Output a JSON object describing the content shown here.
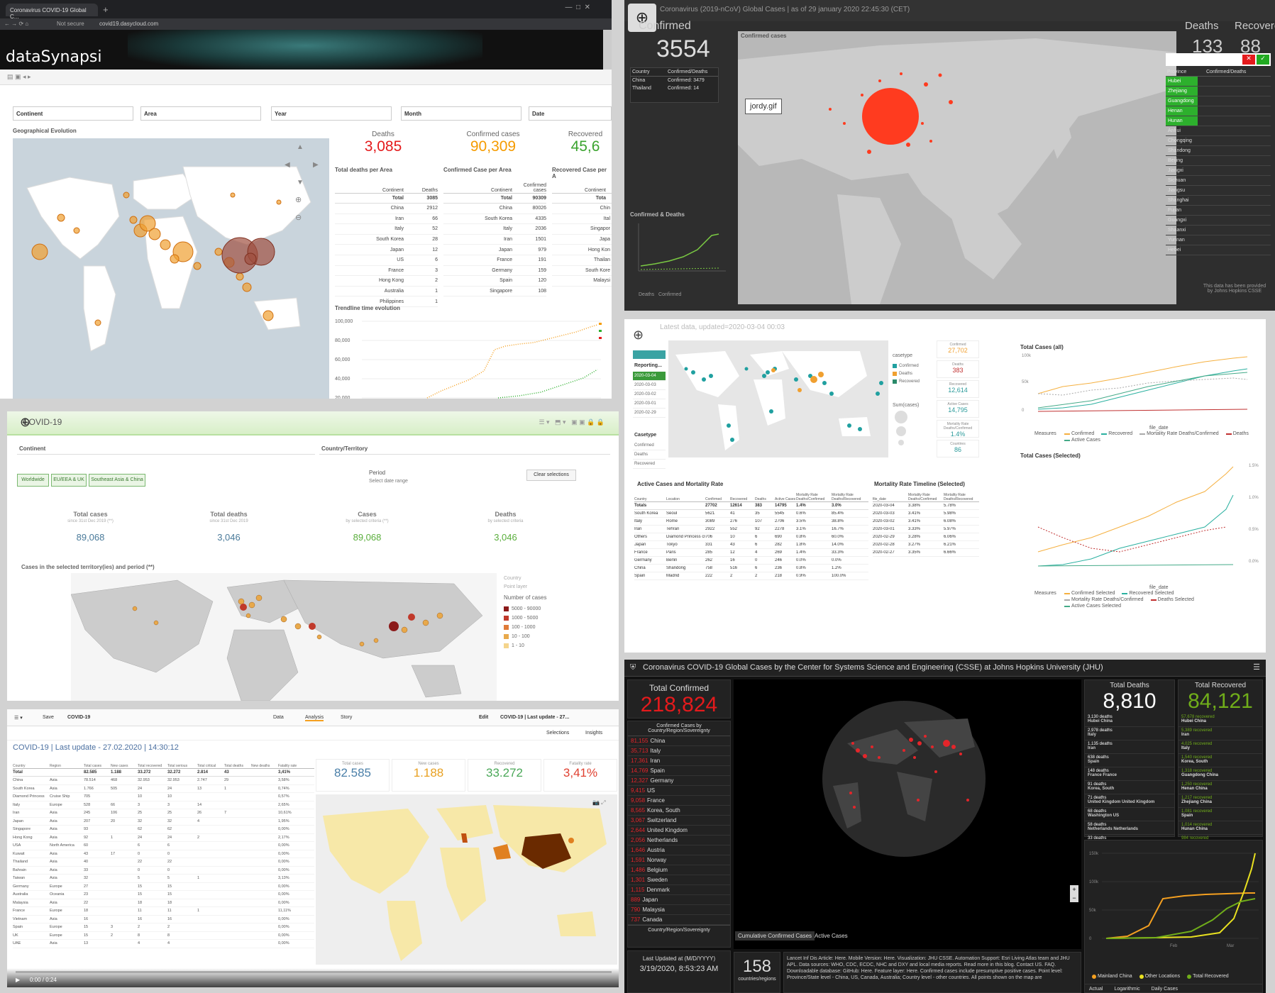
{
  "p1": {
    "tab_title": "Coronavirus COVID-19 Global C...",
    "url": "covid19.dasycloud.com",
    "not_secure": "Not secure",
    "brand": "dataSynapsi",
    "filters": [
      "Continent",
      "Area",
      "Year",
      "Month",
      "Date"
    ],
    "map_title": "Geographical Evolution",
    "kpis": [
      {
        "label": "Deaths",
        "value": "3,085",
        "color": "#e41a1c"
      },
      {
        "label": "Confirmed cases",
        "value": "90,309",
        "color": "#f59b00"
      },
      {
        "label": "Recovered",
        "value": "45,6",
        "color": "#3aa32e"
      }
    ],
    "t1": {
      "title": "Total deaths per Area",
      "h1": "Continent",
      "h2": "Deaths",
      "total_label": "Total",
      "total": "3085",
      "rows": [
        [
          "China",
          "2912"
        ],
        [
          "Iran",
          "66"
        ],
        [
          "Italy",
          "52"
        ],
        [
          "South Korea",
          "28"
        ],
        [
          "Japan",
          "12"
        ],
        [
          "US",
          "6"
        ],
        [
          "France",
          "3"
        ],
        [
          "Hong Kong",
          "2"
        ],
        [
          "Australia",
          "1"
        ],
        [
          "Philippines",
          "1"
        ]
      ]
    },
    "t2": {
      "title": "Confirmed Case per Area",
      "h1": "Continent",
      "h2": "Confirmed cases",
      "total_label": "Total",
      "total": "90309",
      "rows": [
        [
          "China",
          "80026"
        ],
        [
          "South Korea",
          "4335"
        ],
        [
          "Italy",
          "2036"
        ],
        [
          "Iran",
          "1501"
        ],
        [
          "Japan",
          "979"
        ],
        [
          "France",
          "191"
        ],
        [
          "Germany",
          "159"
        ],
        [
          "Spain",
          "120"
        ],
        [
          "Singapore",
          "108"
        ]
      ]
    },
    "t3": {
      "title": "Recovered Case per A",
      "h1": "Continent",
      "total_label": "Tota",
      "rows": [
        "Chin",
        "Ital",
        "Singapor",
        "Japa",
        "Hong Kon",
        "Thailan",
        "South Kore",
        "Malaysi"
      ]
    },
    "trend_title": "Trendline time evolution",
    "trend_ticks": [
      "100,000",
      "80,000",
      "60,000",
      "40,000",
      "20,000"
    ]
  },
  "p2": {
    "title": "Coronavirus (2019-nCoV) Global Cases | as of 29 january 2020 22:45:30 (CET)",
    "confirmed_label": "Confirmed",
    "confirmed": "3554",
    "deaths_label": "Deaths",
    "deaths": "133",
    "recovered_label": "Recovered",
    "recovered": "88",
    "map_label": "Confirmed cases",
    "gif_label": "jordy.gif",
    "left_table": {
      "h1": "Country",
      "h2": "Confirmed/Deaths",
      "rows": [
        [
          "China",
          "Confirmed: 3479"
        ],
        [
          "Thailand",
          "Confirmed: 14"
        ]
      ]
    },
    "chart_label": "Confirmed & Deaths",
    "chart_legend": [
      "Deaths",
      "Confirmed"
    ],
    "right_table": {
      "h1": "Province",
      "h2": "Confirmed/Deaths",
      "rows": [
        "Hubei",
        "Zhejiang",
        "Guangdong",
        "Henan",
        "Hunan",
        "Anhui",
        "Chongqing",
        "Shandong",
        "Beijing",
        "Jiangxi",
        "Sichuan",
        "Jiangsu",
        "Shanghai",
        "Fujian",
        "Guangxi",
        "Shaanxi",
        "Yunnan",
        "Hebei"
      ]
    },
    "footer": "This data has been provided by Johns Hopkins CSSE"
  },
  "p3": {
    "header": "Latest data, updated=2020-03-04 00:03",
    "reporting": "Reporting...",
    "dates": [
      "2020-03-04",
      "2020-03-03",
      "2020-03-02",
      "2020-03-01",
      "2020-02-29"
    ],
    "casetype_label": "Casetype",
    "casetypes": [
      "Confirmed",
      "Deaths",
      "Recovered"
    ],
    "legend_title": "casetype",
    "legend": [
      "Confirmed",
      "Deaths",
      "Recovered"
    ],
    "size_label": "Sum(cases)",
    "kpis": [
      {
        "label": "Confirmed",
        "value": "27,702"
      },
      {
        "label": "Deaths",
        "value": "383"
      },
      {
        "label": "Recovered",
        "value": "12,614"
      },
      {
        "label": "Active Cases",
        "value": "14,795"
      },
      {
        "label": "Mortality Rate Deaths/Confirmed",
        "value": "1.4%"
      },
      {
        "label": "Countries",
        "value": "86"
      }
    ],
    "tbl_title": "Active Cases and Mortality Rate",
    "tbl_head": [
      "Country",
      "Location",
      "Confirmed",
      "Recovered",
      "Deaths",
      "Active Cases",
      "Mortality Rate Deaths/Confirmed",
      "Mortality Rate Deaths/Recovered"
    ],
    "tbl_total": [
      "Totals",
      "",
      "27702",
      "12614",
      "383",
      "14795",
      "1.4%",
      "3.0%"
    ],
    "tbl_rows": [
      [
        "South Korea",
        "Seoul",
        "5621",
        "41",
        "35",
        "5545",
        "0.6%",
        "85.4%"
      ],
      [
        "Italy",
        "Rome",
        "3089",
        "276",
        "107",
        "2706",
        "3.5%",
        "38.8%"
      ],
      [
        "Iran",
        "Tehran",
        "2922",
        "552",
        "92",
        "2278",
        "3.1%",
        "16.7%"
      ],
      [
        "Others",
        "Diamond Princess cruise ship",
        "706",
        "10",
        "6",
        "690",
        "0.8%",
        "60.0%"
      ],
      [
        "Japan",
        "Tokyo",
        "331",
        "43",
        "6",
        "282",
        "1.8%",
        "14.0%"
      ],
      [
        "France",
        "Paris",
        "285",
        "12",
        "4",
        "269",
        "1.4%",
        "33.3%"
      ],
      [
        "Germany",
        "Berlin",
        "262",
        "16",
        "0",
        "246",
        "0.0%",
        "0.0%"
      ],
      [
        "China",
        "Shandong",
        "758",
        "516",
        "6",
        "236",
        "0.8%",
        "1.2%"
      ],
      [
        "Spain",
        "Madrid",
        "222",
        "2",
        "2",
        "218",
        "0.9%",
        "100.0%"
      ]
    ],
    "timeline_title": "Mortality Rate Timeline (Selected)",
    "timeline_head": [
      "file_date",
      "Mortality Rate Deaths/Confirmed",
      "Mortality Rate Deaths/Recovered"
    ],
    "timeline_rows": [
      [
        "2020-03-04",
        "3.38%",
        "5.78%"
      ],
      [
        "2020-03-03",
        "3.41%",
        "5.98%"
      ],
      [
        "2020-03-02",
        "3.41%",
        "6.08%"
      ],
      [
        "2020-03-01",
        "3.33%",
        "5.97%"
      ],
      [
        "2020-02-29",
        "3.28%",
        "6.06%"
      ],
      [
        "2020-02-28",
        "3.27%",
        "6.21%"
      ],
      [
        "2020-02-27",
        "3.35%",
        "6.66%"
      ]
    ],
    "chart1_title": "Total Cases (all)",
    "chart1_legend": [
      "Confirmed",
      "Recovered",
      "Mortality Rate Deaths/Confirmed",
      "Deaths",
      "Active Cases"
    ],
    "chart1_measures": "Measures",
    "chart1_x": "file_date",
    "chart2_title": "Total Cases (Selected)",
    "chart2_legend": [
      "Confirmed Selected",
      "Recovered Selected",
      "Mortality Rate Deaths/Confirmed",
      "Deaths Selected",
      "Active Cases Selected"
    ],
    "chart2_measures": "Measures",
    "chart2_x": "file_date",
    "c1_y": [
      "100k",
      "50k",
      "0"
    ],
    "c2_y": [
      "1.5%",
      "1.0%",
      "0.5%",
      "0.0%"
    ]
  },
  "p4": {
    "title": "COVID-19",
    "filters": [
      "Continent",
      "Country/Territory"
    ],
    "buttons": [
      "Worldwide",
      "EU/EEA & UK",
      "Southeast Asia & China"
    ],
    "period_label": "Period",
    "period_value": "Select date range",
    "clear": "Clear selections",
    "kpis": [
      {
        "label": "Total cases",
        "sub": "since 31st Dec 2019 (**)",
        "value": "89,068",
        "color": "#4a7a9a"
      },
      {
        "label": "Total deaths",
        "sub": "since 31st Dec 2019",
        "value": "3,046",
        "color": "#4a7a9a"
      },
      {
        "label": "Cases",
        "sub": "by selected criteria (**)",
        "value": "89,068",
        "color": "#5aae3c"
      },
      {
        "label": "Deaths",
        "sub": "by selected criteria",
        "value": "3,046",
        "color": "#5aae3c"
      }
    ],
    "map_title": "Cases in the selected territory(ies) and period (**)",
    "legend_title": "Country",
    "legend_sub": "Point layer",
    "legend_head": "Number of cases",
    "legend": [
      [
        "5000 - 90000",
        "#8b1a1a"
      ],
      [
        "1000 - 5000",
        "#c0392b"
      ],
      [
        "100 - 1000",
        "#e07b39"
      ],
      [
        "10 - 100",
        "#e8a94b"
      ],
      [
        "1 - 10",
        "#f4d58d"
      ]
    ]
  },
  "p5": {
    "menu": [
      "Save",
      "COVID-19"
    ],
    "tabs": [
      "Data",
      "Analysis",
      "Story"
    ],
    "tabbar_right": [
      "Edit",
      "COVID-19 | Last update - 27..."
    ],
    "sel": [
      "Selections",
      "Insights"
    ],
    "title": "COVID-19 | Last update - 27.02.2020 | 14:30:12",
    "tbl_head": [
      "Country",
      "Region",
      "Total cases",
      "New cases",
      "Total recovered",
      "Total serious",
      "Total critical",
      "Total deaths",
      "New deaths",
      "Fatality rate"
    ],
    "tbl_total": [
      "Total",
      "",
      "82.585",
      "1.188",
      "33.272",
      "32.272",
      "2.814",
      "43",
      "",
      "3,41%"
    ],
    "tbl_rows": [
      [
        "China",
        "Asia",
        "78.514",
        "468",
        "32.953",
        "32.953",
        "2.747",
        "29",
        "",
        "3,58%"
      ],
      [
        "South Korea",
        "Asia",
        "1.766",
        "505",
        "24",
        "24",
        "13",
        "1",
        "",
        "0,74%"
      ],
      [
        "Diamond Princess",
        "Cruise Ship",
        "705",
        "",
        "10",
        "10",
        "",
        "",
        "",
        "0,57%"
      ],
      [
        "Italy",
        "Europe",
        "528",
        "66",
        "3",
        "3",
        "14",
        "",
        "",
        "2,65%"
      ],
      [
        "Iran",
        "Asia",
        "245",
        "106",
        "25",
        "25",
        "26",
        "7",
        "",
        "10,61%"
      ],
      [
        "Japan",
        "Asia",
        "207",
        "20",
        "32",
        "32",
        "4",
        "",
        "",
        "1,95%"
      ],
      [
        "Singapore",
        "Asia",
        "93",
        "",
        "62",
        "62",
        "",
        "",
        "",
        "0,00%"
      ],
      [
        "Hong Kong",
        "Asia",
        "92",
        "1",
        "24",
        "24",
        "2",
        "",
        "",
        "2,17%"
      ],
      [
        "USA",
        "North America",
        "60",
        "",
        "6",
        "6",
        "",
        "",
        "",
        "0,00%"
      ],
      [
        "Kuwait",
        "Asia",
        "43",
        "17",
        "0",
        "0",
        "",
        "",
        "",
        "0,00%"
      ],
      [
        "Thailand",
        "Asia",
        "40",
        "",
        "22",
        "22",
        "",
        "",
        "",
        "0,00%"
      ],
      [
        "Bahrain",
        "Asia",
        "33",
        "",
        "0",
        "0",
        "",
        "",
        "",
        "0,00%"
      ],
      [
        "Taiwan",
        "Asia",
        "32",
        "",
        "5",
        "5",
        "1",
        "",
        "",
        "3,13%"
      ],
      [
        "Germany",
        "Europe",
        "27",
        "",
        "15",
        "15",
        "",
        "",
        "",
        "0,00%"
      ],
      [
        "Australia",
        "Oceania",
        "23",
        "",
        "15",
        "15",
        "",
        "",
        "",
        "0,00%"
      ],
      [
        "Malaysia",
        "Asia",
        "22",
        "",
        "18",
        "18",
        "",
        "",
        "",
        "0,00%"
      ],
      [
        "France",
        "Europe",
        "18",
        "",
        "11",
        "11",
        "1",
        "",
        "",
        "11,11%"
      ],
      [
        "Vietnam",
        "Asia",
        "16",
        "",
        "16",
        "16",
        "",
        "",
        "",
        "0,00%"
      ],
      [
        "Spain",
        "Europe",
        "15",
        "3",
        "2",
        "2",
        "",
        "",
        "",
        "0,00%"
      ],
      [
        "UK",
        "Europe",
        "15",
        "2",
        "8",
        "8",
        "",
        "",
        "",
        "0,00%"
      ],
      [
        "UAE",
        "Asia",
        "13",
        "",
        "4",
        "4",
        "",
        "",
        "",
        "0,00%"
      ]
    ],
    "kpis": [
      {
        "label": "Total cases",
        "value": "82.585",
        "color": "#4a7fa8"
      },
      {
        "label": "New cases",
        "value": "1.188",
        "color": "#e8a020"
      },
      {
        "label": "Recovered",
        "value": "33.272",
        "color": "#4aa858"
      },
      {
        "label": "Fatality rate",
        "value": "3,41%",
        "color": "#e04030"
      }
    ],
    "video_time": "0:00 / 0:24"
  },
  "p6": {
    "title": "Coronavirus COVID-19 Global Cases by the Center for Systems Science and Engineering (CSSE) at Johns Hopkins University (JHU)",
    "tc_label": "Total Confirmed",
    "tc": "218,824",
    "list_title": "Confirmed Cases by Country/Region/Sovereignty",
    "list": [
      [
        "81,155",
        "China"
      ],
      [
        "35,713",
        "Italy"
      ],
      [
        "17,361",
        "Iran"
      ],
      [
        "14,769",
        "Spain"
      ],
      [
        "12,327",
        "Germany"
      ],
      [
        "9,415",
        "US"
      ],
      [
        "9,058",
        "France"
      ],
      [
        "8,565",
        "Korea, South"
      ],
      [
        "3,067",
        "Switzerland"
      ],
      [
        "2,644",
        "United Kingdom"
      ],
      [
        "2,056",
        "Netherlands"
      ],
      [
        "1,646",
        "Austria"
      ],
      [
        "1,591",
        "Norway"
      ],
      [
        "1,486",
        "Belgium"
      ],
      [
        "1,301",
        "Sweden"
      ],
      [
        "1,115",
        "Denmark"
      ],
      [
        "889",
        "Japan"
      ],
      [
        "790",
        "Malaysia"
      ],
      [
        "737",
        "Canada"
      ]
    ],
    "list_footer": "Country/Region/Sovereignty",
    "updated_label": "Last Updated at (M/D/YYYY)",
    "updated": "3/19/2020, 8:53:23 AM",
    "td_label": "Total Deaths",
    "td": "8,810",
    "deaths": [
      [
        "3,130 deaths",
        "Hubei China"
      ],
      [
        "2,978 deaths",
        "Italy"
      ],
      [
        "1,135 deaths",
        "Iran"
      ],
      [
        "638 deaths",
        "Spain"
      ],
      [
        "148 deaths",
        "France France"
      ],
      [
        "91 deaths",
        "Korea, South"
      ],
      [
        "71 deaths",
        "United Kingdom United Kingdom"
      ],
      [
        "68 deaths",
        "Washington US"
      ],
      [
        "58 deaths",
        "Netherlands Netherlands"
      ],
      [
        "33 deaths",
        "Switzerland"
      ]
    ],
    "tr_label": "Total Recovered",
    "tr": "84,121",
    "recovered": [
      [
        "57,678 recovered",
        "Hubei China"
      ],
      [
        "5,389 recovered",
        "Iran"
      ],
      [
        "4,025 recovered",
        "Italy"
      ],
      [
        "1,540 recovered",
        "Korea, South"
      ],
      [
        "1,318 recovered",
        "Guangdong China"
      ],
      [
        "1,250 recovered",
        "Henan China"
      ],
      [
        "1,217 recovered",
        "Zhejiang China"
      ],
      [
        "1,081 recovered",
        "Spain"
      ],
      [
        "1,014 recovered",
        "Hunan China"
      ],
      [
        "984 recovered",
        "Anhui China"
      ]
    ],
    "map_tabs": [
      "Cumulative Confirmed Cases",
      "Active Cases"
    ],
    "countries": "158",
    "countries_label": "countries/regions",
    "notes": "Lancet Inf Dis Article: Here. Mobile Version: Here. Visualization: JHU CSSE. Automation Support: Esri Living Atlas team and JHU APL. Data sources: WHO, CDC, ECDC, NHC and DXY and local media reports. Read more in this blog. Contact US. FAQ. Downloadable database: GitHub: Here. Feature layer: Here. Confirmed cases include presumptive positive cases. Point level: Province/State level - China, US, Canada, Australia; Country level - other countries. All points shown on the map are",
    "chart_legend": [
      "Mainland China",
      "Other Locations",
      "Total Recovered"
    ],
    "chart_tabs": [
      "Actual",
      "Logarithmic",
      "Daily Cases"
    ],
    "chart_y": [
      "150k",
      "100k",
      "50k",
      "0"
    ],
    "chart_x": [
      "Feb",
      "Mar"
    ]
  },
  "colors": {
    "red": "#e41a1c",
    "orange": "#f59b00",
    "green": "#3aa32e",
    "dark": "#111111"
  }
}
